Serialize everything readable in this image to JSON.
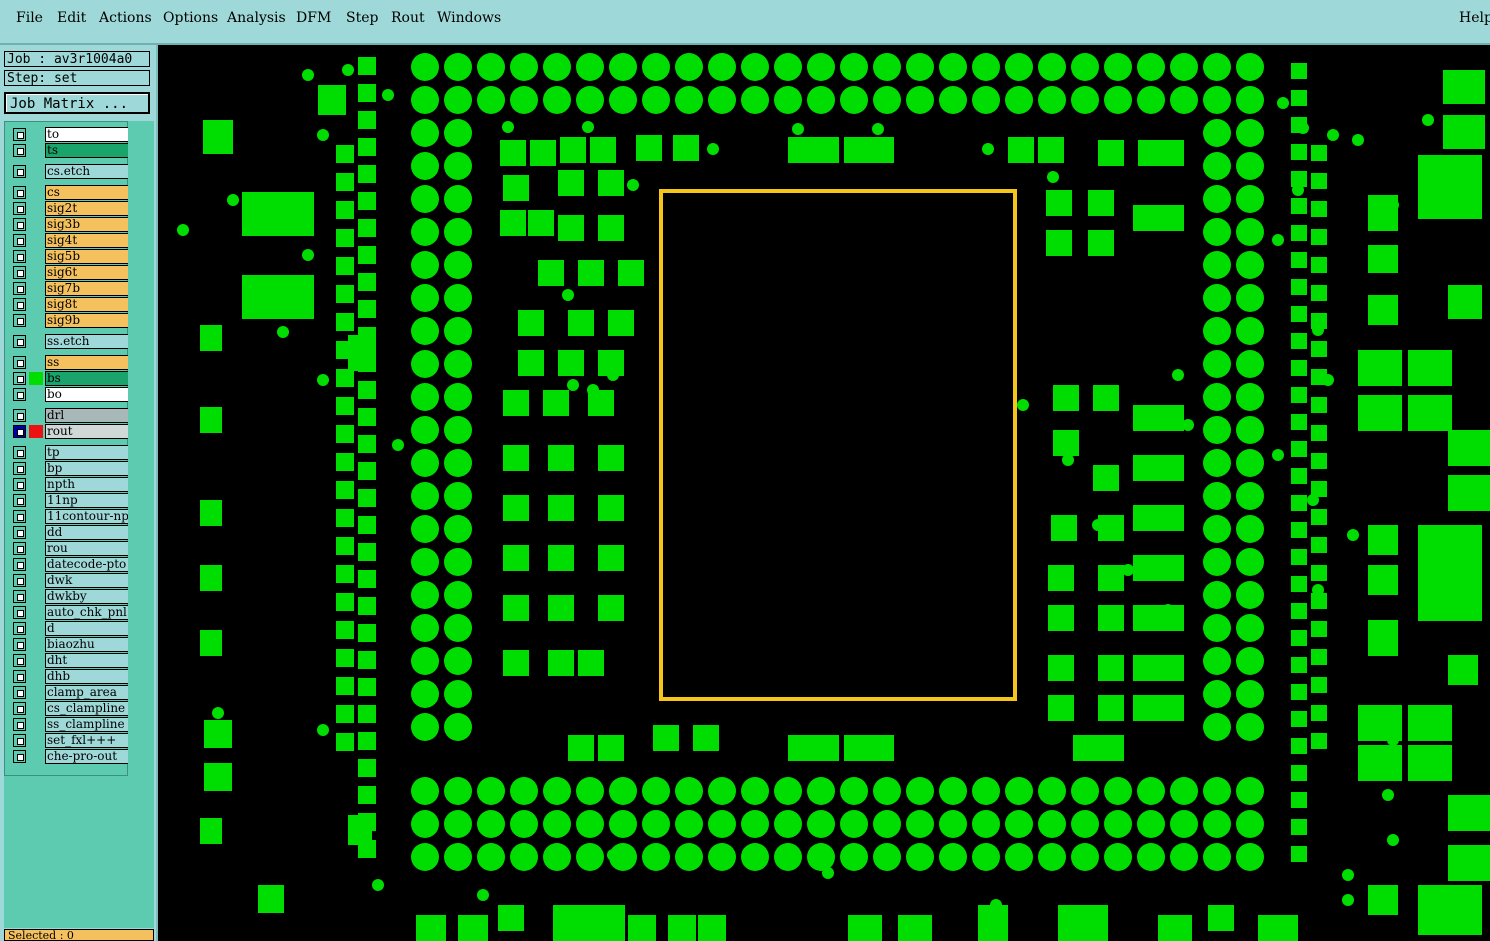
{
  "menubar": {
    "items": [
      "File",
      "Edit",
      "Actions",
      "Options",
      "Analysis",
      "DFM",
      "Step",
      "Rout",
      "Windows"
    ],
    "help": "Help"
  },
  "info": {
    "job": "Job : av3r1004a0",
    "step": "Step: set",
    "job_matrix": "Job Matrix ..."
  },
  "layers": [
    {
      "name": "to",
      "color": "#ffffff"
    },
    {
      "name": "ts",
      "color": "#1aa36b"
    },
    {
      "name": "cs.etch",
      "color": "#9fd8d8"
    },
    {
      "name": "cs",
      "color": "#f4c15e"
    },
    {
      "name": "sig2t",
      "color": "#f4c15e"
    },
    {
      "name": "sig3b",
      "color": "#f4c15e"
    },
    {
      "name": "sig4t",
      "color": "#f4c15e"
    },
    {
      "name": "sig5b",
      "color": "#f4c15e"
    },
    {
      "name": "sig6t",
      "color": "#f4c15e"
    },
    {
      "name": "sig7b",
      "color": "#f4c15e"
    },
    {
      "name": "sig8t",
      "color": "#f4c15e"
    },
    {
      "name": "sig9b",
      "color": "#f4c15e"
    },
    {
      "name": "ss.etch",
      "color": "#9fd8d8"
    },
    {
      "name": "ss",
      "color": "#f4c15e"
    },
    {
      "name": "bs",
      "color": "#1aa36b"
    },
    {
      "name": "bo",
      "color": "#ffffff"
    },
    {
      "name": "drl",
      "color": "#a8b8b8"
    },
    {
      "name": "rout",
      "color": "#d0d8d8"
    },
    {
      "name": "tp",
      "color": "#9fd8d8"
    },
    {
      "name": "bp",
      "color": "#9fd8d8"
    },
    {
      "name": "npth",
      "color": "#9fd8d8"
    },
    {
      "name": "11np",
      "color": "#9fd8d8"
    },
    {
      "name": "11contour-np",
      "color": "#9fd8d8"
    },
    {
      "name": "dd",
      "color": "#9fd8d8"
    },
    {
      "name": "rou",
      "color": "#9fd8d8"
    },
    {
      "name": "datecode-pto",
      "color": "#9fd8d8"
    },
    {
      "name": "dwk",
      "color": "#9fd8d8"
    },
    {
      "name": "dwkby",
      "color": "#9fd8d8"
    },
    {
      "name": "auto_chk_pnl",
      "color": "#9fd8d8"
    },
    {
      "name": "d",
      "color": "#9fd8d8"
    },
    {
      "name": "biaozhu",
      "color": "#9fd8d8"
    },
    {
      "name": "dht",
      "color": "#9fd8d8"
    },
    {
      "name": "dhb",
      "color": "#9fd8d8"
    },
    {
      "name": "clamp_area",
      "color": "#9fd8d8"
    },
    {
      "name": "cs_clampline",
      "color": "#9fd8d8"
    },
    {
      "name": "ss_clampline",
      "color": "#9fd8d8"
    },
    {
      "name": "set_fxl+++",
      "color": "#9fd8d8"
    },
    {
      "name": "che-pro-out",
      "color": "#9fd8d8"
    }
  ],
  "status": "Selected : 0",
  "colors": {
    "pad": "#00dd00",
    "outline": "#f5c518",
    "canvas_bg": "#000000"
  }
}
